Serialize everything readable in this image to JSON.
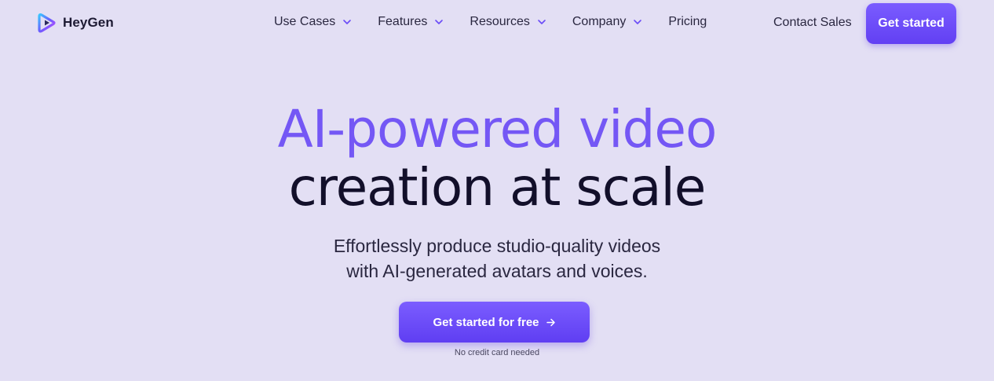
{
  "brand": {
    "name": "HeyGen",
    "logo_icon": "heygen-play-logo",
    "accent": "#7457f5",
    "button": "#6a4bf7",
    "background": "#e3dff4",
    "text_dark": "#120f2a"
  },
  "nav": {
    "items": [
      {
        "label": "Use Cases",
        "icon": "chevron-down-icon"
      },
      {
        "label": "Features",
        "icon": "chevron-down-icon"
      },
      {
        "label": "Resources",
        "icon": "chevron-down-icon"
      },
      {
        "label": "Company",
        "icon": "chevron-down-icon"
      },
      {
        "label": "Pricing"
      }
    ],
    "contact_label": "Contact Sales",
    "cta_label": "Get started"
  },
  "hero": {
    "title_line1": "AI-powered video",
    "title_line2": "creation at scale",
    "subtitle_line1": "Effortlessly produce studio-quality videos",
    "subtitle_line2": "with AI-generated avatars and voices.",
    "cta_label": "Get started for free",
    "cta_icon": "arrow-right-icon",
    "note": "No credit card needed"
  }
}
